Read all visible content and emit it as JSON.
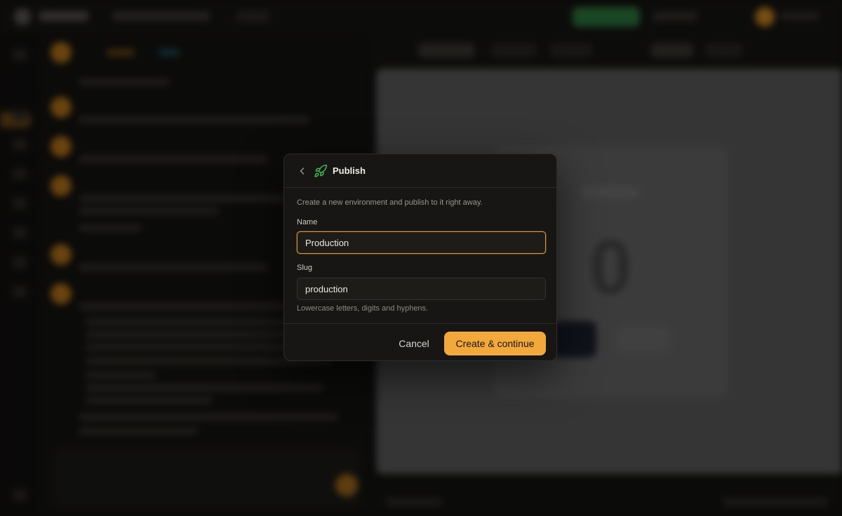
{
  "dialog": {
    "title": "Publish",
    "description": "Create a new environment and publish to it right away.",
    "name_label": "Name",
    "name_value": "Production",
    "slug_label": "Slug",
    "slug_value": "production",
    "slug_hint": "Lowercase letters, digits and hyphens.",
    "cancel_label": "Cancel",
    "submit_label": "Create & continue",
    "icons": {
      "back": "chevron-left-icon",
      "title": "rocket-icon"
    }
  },
  "background": {
    "preview_counter": "0"
  },
  "colors": {
    "accent": "#f3a83c",
    "focus_border": "#d89a34",
    "rocket_icon": "#3fb950",
    "dialog_bg": "#171614"
  }
}
